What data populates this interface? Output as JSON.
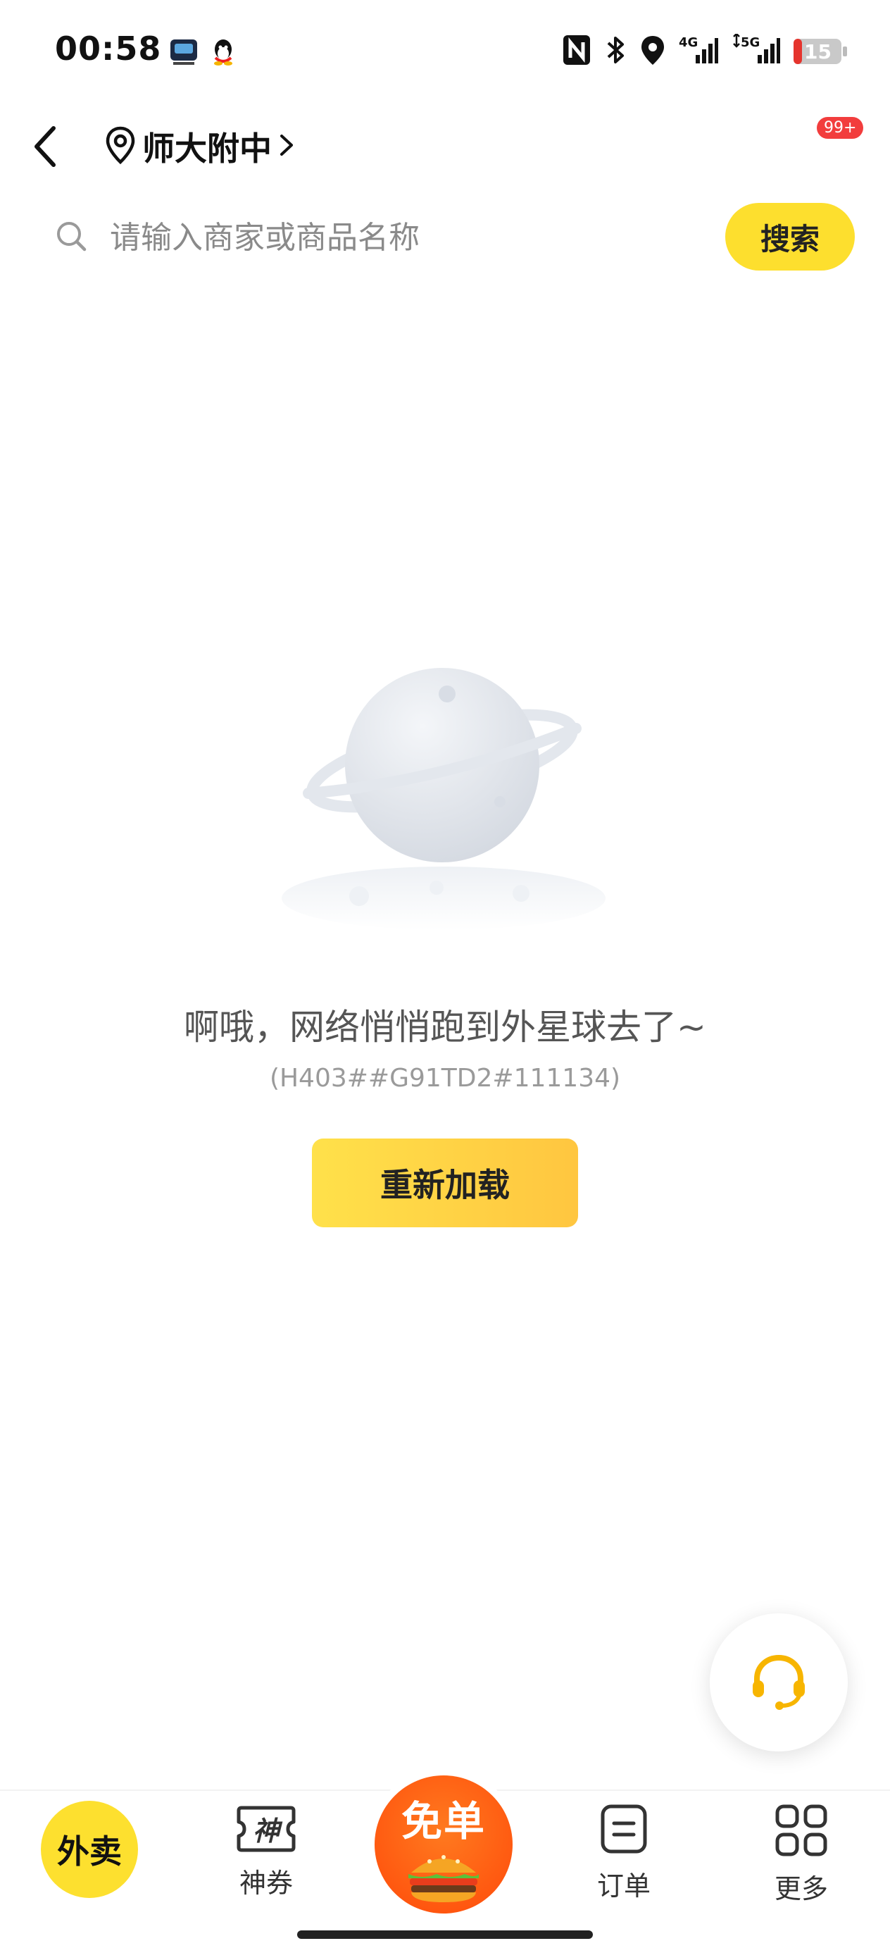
{
  "status_bar": {
    "time": "00:58",
    "battery": "15"
  },
  "header": {
    "location": "师大附中",
    "message_badge": "99+"
  },
  "search": {
    "placeholder": "请输入商家或商品名称",
    "button_label": "搜索"
  },
  "empty_state": {
    "title": "啊哦，网络悄悄跑到外星球去了~",
    "error_code": "(H403##G91TD2#111134)",
    "reload_label": "重新加载"
  },
  "bottom_nav": {
    "waimai": "外卖",
    "coupon": "神券",
    "coupon_icon_text": "神",
    "free_order": "免单",
    "orders": "订单",
    "more": "更多"
  },
  "colors": {
    "accent": "#fddf2e",
    "badge": "#f23d3d",
    "free_order": "#ff5a10"
  }
}
